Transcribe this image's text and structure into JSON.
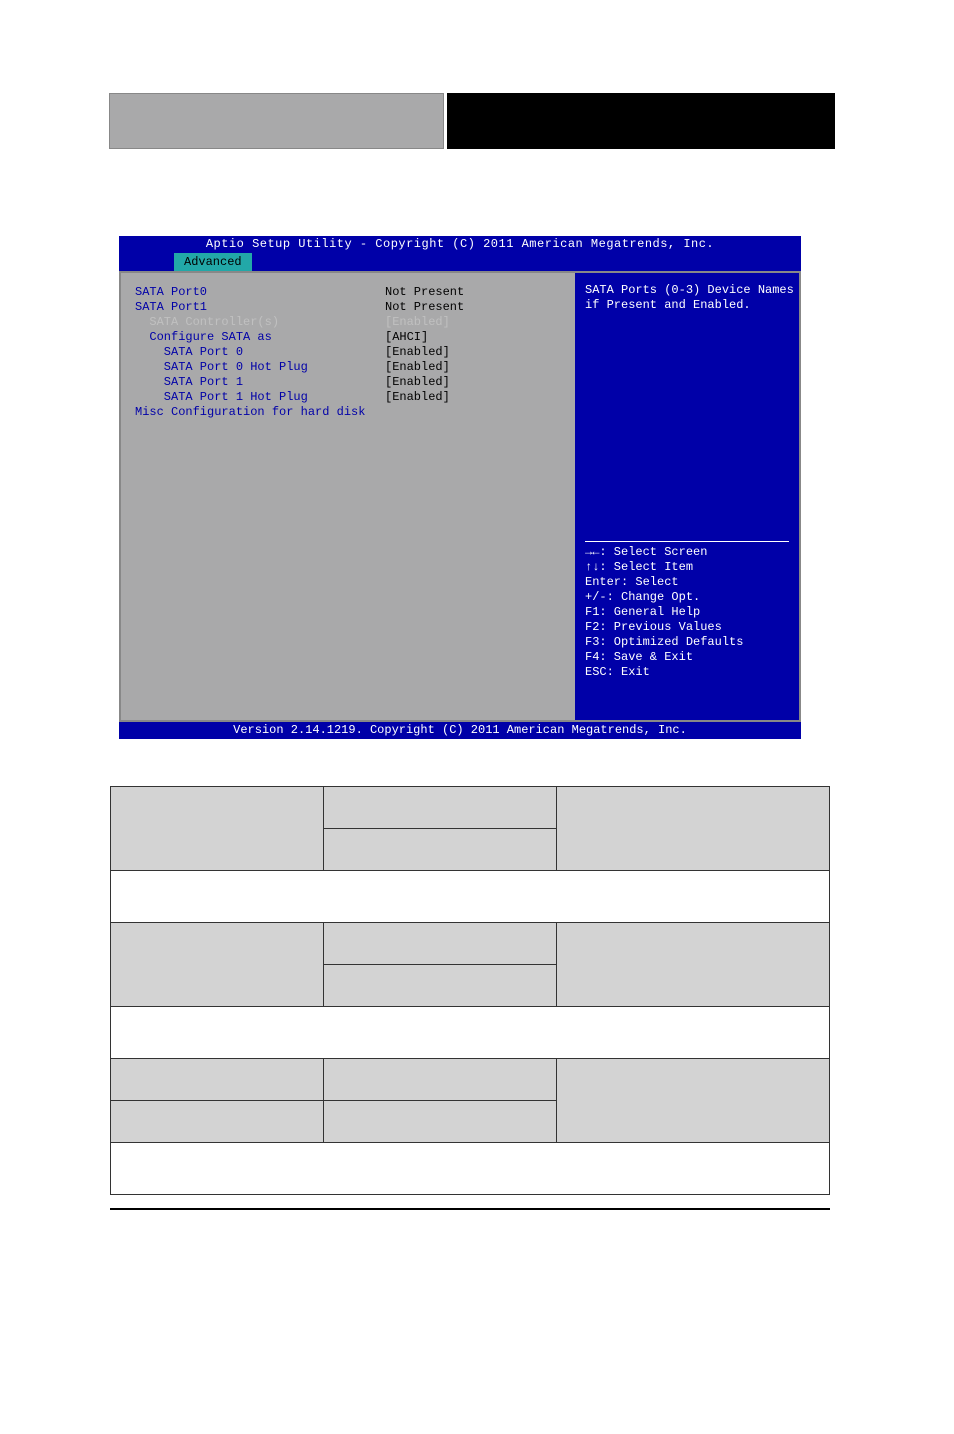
{
  "bios": {
    "header": "Aptio Setup Utility - Copyright (C) 2011 American Megatrends, Inc.",
    "tab": "Advanced",
    "footer": "Version 2.14.1219. Copyright (C) 2011 American Megatrends, Inc.",
    "rows": [
      {
        "label": "SATA Port0",
        "value": "Not Present",
        "indent": 0,
        "lblcls": "",
        "valcls": "val"
      },
      {
        "label": "SATA Port1",
        "value": "Not Present",
        "indent": 0,
        "lblcls": "",
        "valcls": "val"
      },
      {
        "label": "",
        "value": "",
        "indent": 0,
        "lblcls": "",
        "valcls": ""
      },
      {
        "label": "SATA Controller(s)",
        "value": "[Enabled]",
        "indent": 1,
        "lblcls": "sel",
        "valcls": "sel"
      },
      {
        "label": "",
        "value": "",
        "indent": 0,
        "lblcls": "",
        "valcls": ""
      },
      {
        "label": "Configure SATA as",
        "value": "[AHCI]",
        "indent": 1,
        "lblcls": "",
        "valcls": ""
      },
      {
        "label": "",
        "value": "",
        "indent": 0,
        "lblcls": "",
        "valcls": ""
      },
      {
        "label": "SATA Port 0",
        "value": "[Enabled]",
        "indent": 2,
        "lblcls": "",
        "valcls": ""
      },
      {
        "label": "SATA Port 0 Hot Plug",
        "value": "[Enabled]",
        "indent": 2,
        "lblcls": "",
        "valcls": ""
      },
      {
        "label": "SATA Port 1",
        "value": "[Enabled]",
        "indent": 2,
        "lblcls": "",
        "valcls": ""
      },
      {
        "label": "SATA Port 1 Hot Plug",
        "value": "[Enabled]",
        "indent": 2,
        "lblcls": "",
        "valcls": ""
      },
      {
        "label": "",
        "value": "",
        "indent": 0,
        "lblcls": "",
        "valcls": ""
      },
      {
        "label": "Misc Configuration for hard disk",
        "value": "",
        "indent": 0,
        "lblcls": "",
        "valcls": "val"
      }
    ],
    "help": "SATA Ports (0-3) Device Names\nif Present and Enabled.",
    "keys": "→←: Select Screen\n↑↓: Select Item\nEnter: Select\n+/-: Change Opt.\nF1: General Help\nF2: Previous Values\nF3: Optimized Defaults\nF4: Save & Exit\nESC: Exit"
  }
}
